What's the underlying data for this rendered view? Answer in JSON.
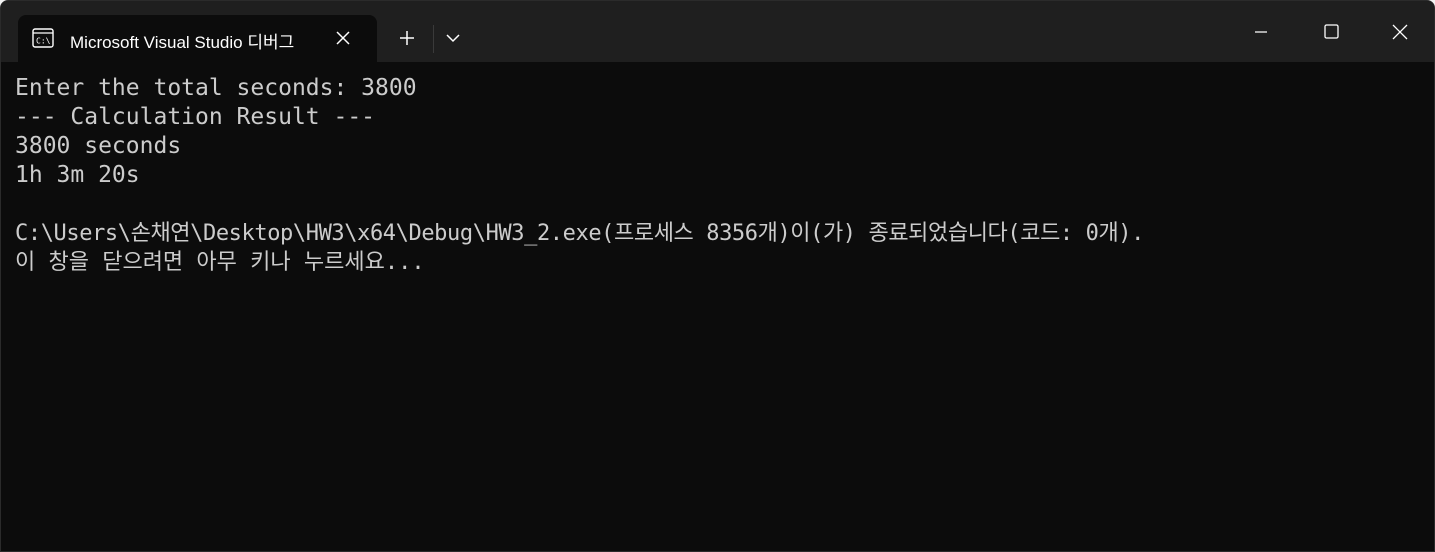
{
  "tab": {
    "title": "Microsoft Visual Studio 디버그",
    "icon": "console-app-icon"
  },
  "titlebar": {
    "new_tab": "+",
    "dropdown": "chevron-down"
  },
  "console": {
    "lines": [
      "Enter the total seconds: 3800",
      "--- Calculation Result ---",
      "3800 seconds",
      "1h 3m 20s",
      "",
      "C:\\Users\\손채연\\Desktop\\HW3\\x64\\Debug\\HW3_2.exe(프로세스 8356개)이(가) 종료되었습니다(코드: 0개).",
      "이 창을 닫으려면 아무 키나 누르세요..."
    ]
  },
  "colors": {
    "titlebar_bg": "#1f1f1f",
    "console_bg": "#0c0c0c",
    "console_text": "#cccccc"
  }
}
